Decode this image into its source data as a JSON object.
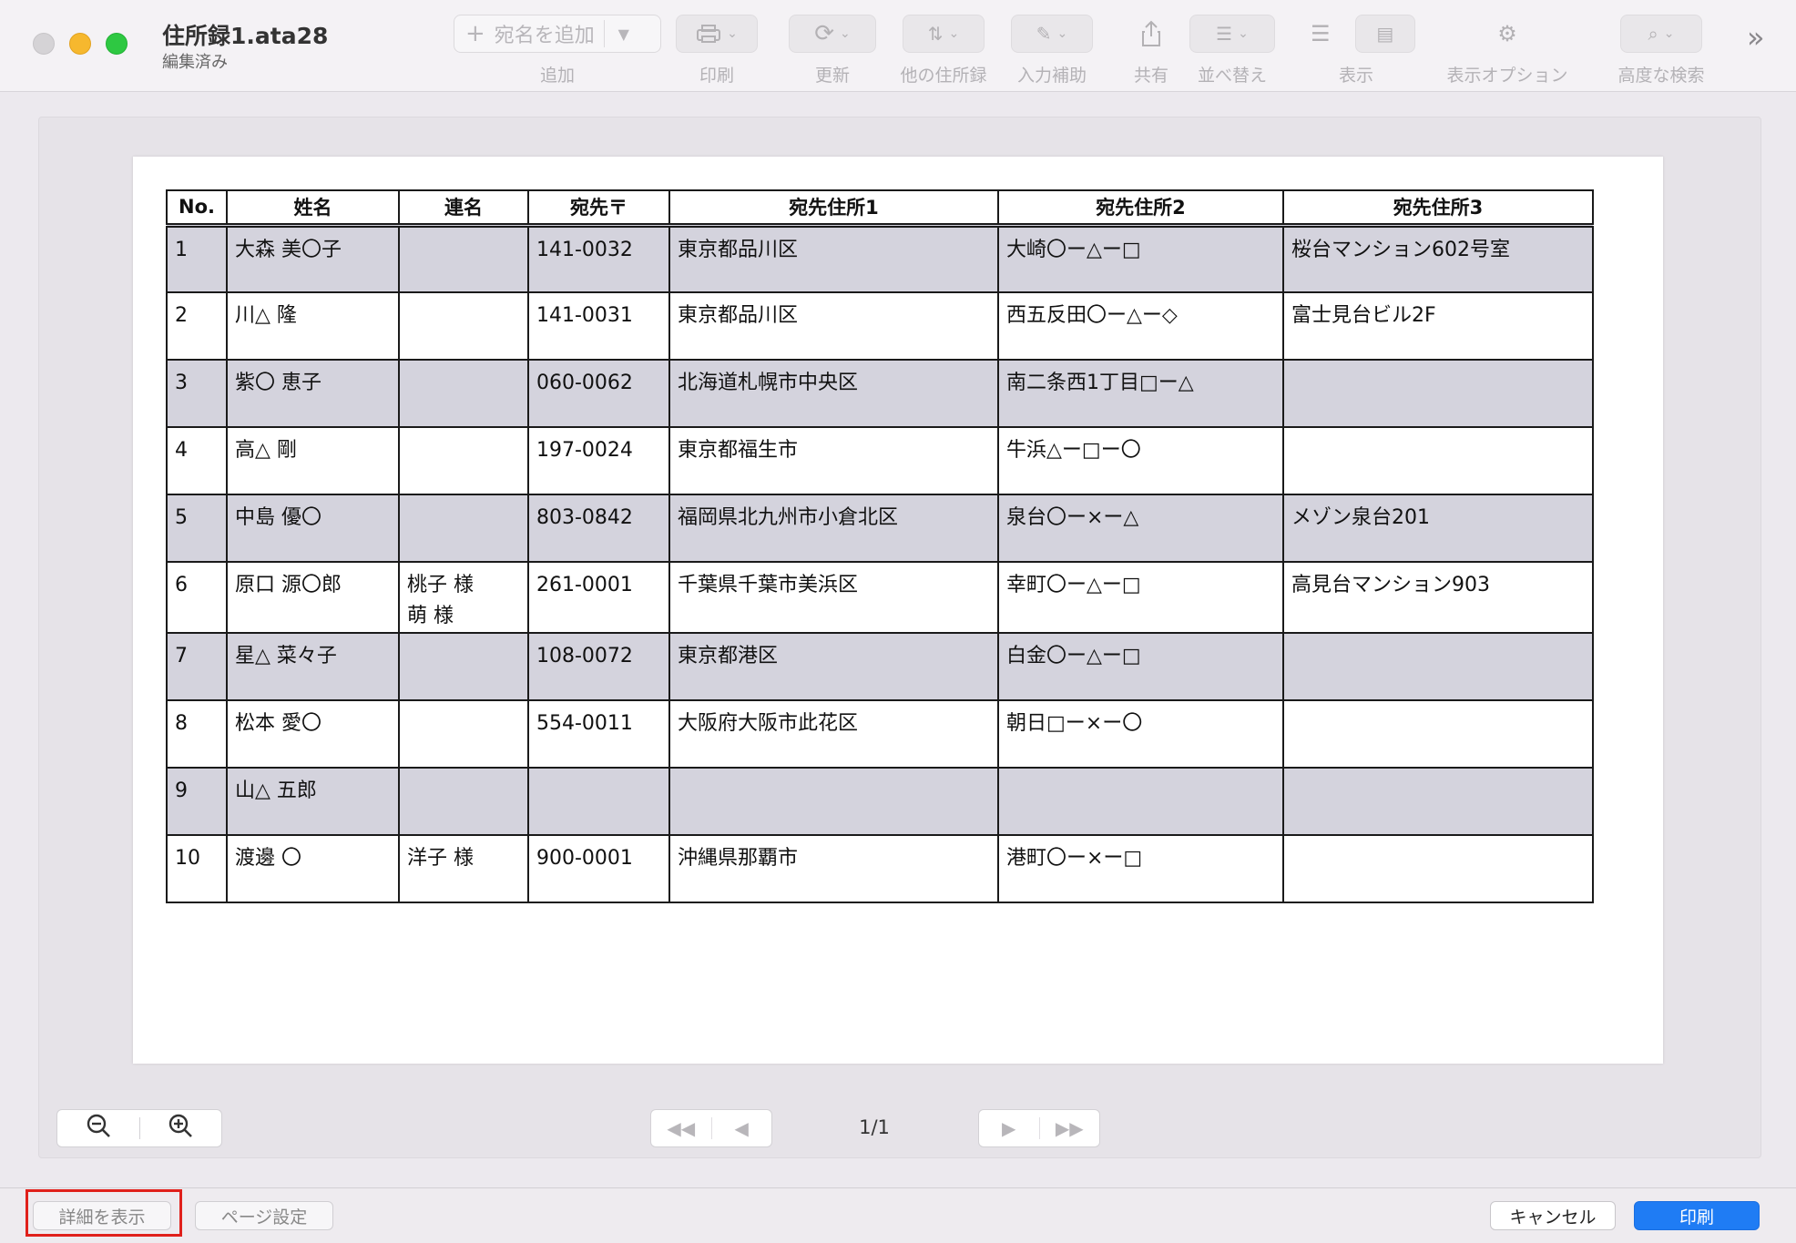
{
  "window": {
    "title": "住所録1.ata28",
    "subtitle": "編集済み"
  },
  "toolbar": {
    "add_placeholder": "宛名を追加",
    "items": [
      {
        "label": "追加"
      },
      {
        "label": "印刷"
      },
      {
        "label": "更新"
      },
      {
        "label": "他の住所録"
      },
      {
        "label": "入力補助"
      },
      {
        "label": "共有"
      },
      {
        "label": "並べ替え"
      },
      {
        "label": "表示"
      },
      {
        "label": "表示オプション"
      },
      {
        "label": "高度な検索"
      }
    ]
  },
  "table": {
    "headers": [
      "No.",
      "姓名",
      "連名",
      "宛先〒",
      "宛先住所1",
      "宛先住所2",
      "宛先住所3"
    ],
    "rows": [
      {
        "no": "1",
        "name": "大森 美〇子",
        "renmei": "",
        "zip": "141-0032",
        "addr1": "東京都品川区",
        "addr2": "大崎〇ー△ー□",
        "addr3": "桜台マンション602号室"
      },
      {
        "no": "2",
        "name": "川△ 隆",
        "renmei": "",
        "zip": "141-0031",
        "addr1": "東京都品川区",
        "addr2": "西五反田〇ー△ー◇",
        "addr3": "富士見台ビル2F"
      },
      {
        "no": "3",
        "name": "紫〇 恵子",
        "renmei": "",
        "zip": "060-0062",
        "addr1": "北海道札幌市中央区",
        "addr2": "南二条西1丁目□ー△",
        "addr3": ""
      },
      {
        "no": "4",
        "name": "高△ 剛",
        "renmei": "",
        "zip": "197-0024",
        "addr1": "東京都福生市",
        "addr2": "牛浜△ー□ー〇",
        "addr3": ""
      },
      {
        "no": "5",
        "name": "中島 優〇",
        "renmei": "",
        "zip": "803-0842",
        "addr1": "福岡県北九州市小倉北区",
        "addr2": "泉台〇ー×ー△",
        "addr3": "メゾン泉台201"
      },
      {
        "no": "6",
        "name": "原口 源〇郎",
        "renmei": "桃子 様\n萌 様",
        "zip": "261-0001",
        "addr1": "千葉県千葉市美浜区",
        "addr2": "幸町〇ー△ー□",
        "addr3": "高見台マンション903"
      },
      {
        "no": "7",
        "name": "星△ 菜々子",
        "renmei": "",
        "zip": "108-0072",
        "addr1": "東京都港区",
        "addr2": "白金〇ー△ー□",
        "addr3": ""
      },
      {
        "no": "8",
        "name": "松本 愛〇",
        "renmei": "",
        "zip": "554-0011",
        "addr1": "大阪府大阪市此花区",
        "addr2": "朝日□ー×ー〇",
        "addr3": ""
      },
      {
        "no": "9",
        "name": "山△ 五郎",
        "renmei": "",
        "zip": "",
        "addr1": "",
        "addr2": "",
        "addr3": ""
      },
      {
        "no": "10",
        "name": "渡邊 〇",
        "renmei": "洋子 様",
        "zip": "900-0001",
        "addr1": "沖縄県那覇市",
        "addr2": "港町〇ー×ー□",
        "addr3": ""
      }
    ]
  },
  "pager": {
    "page_indicator": "1/1"
  },
  "bottom": {
    "details_label": "詳細を表示",
    "page_setup_label": "ページ設定",
    "cancel_label": "キャンセル",
    "print_label": "印刷"
  },
  "icons": {
    "zoom_out": "zoom-out-icon",
    "zoom_in": "zoom-in-icon"
  },
  "colors": {
    "accent": "#1f7cf4",
    "row_shade": "#d4d3dd",
    "highlight": "#e0201b"
  }
}
